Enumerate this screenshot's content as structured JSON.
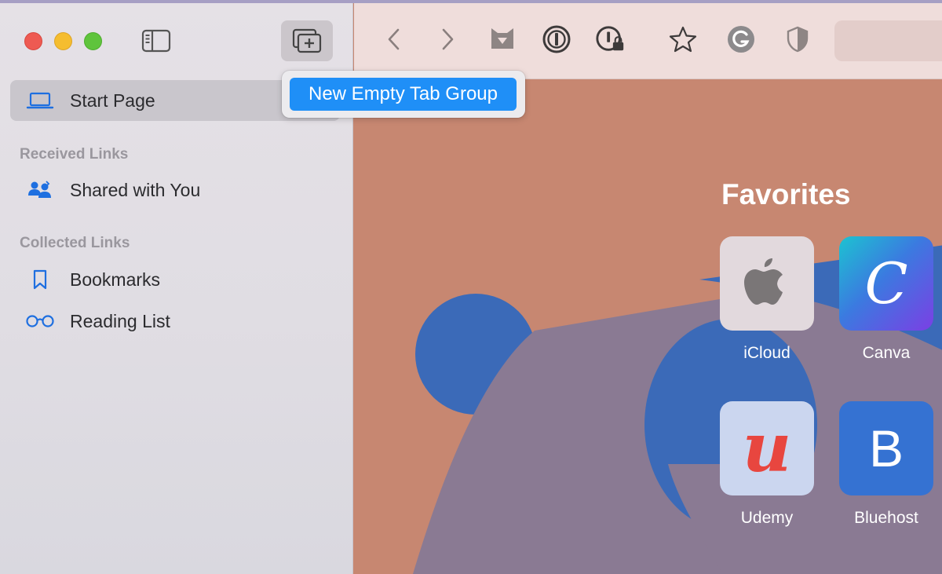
{
  "tooltip": {
    "new_empty_tab_group": "New Empty Tab Group"
  },
  "sidebar": {
    "start_page": "Start Page",
    "sections": [
      {
        "header": "Received Links",
        "items": [
          {
            "label": "Shared with You",
            "icon": "shared-with-you-icon"
          }
        ]
      },
      {
        "header": "Collected Links",
        "items": [
          {
            "label": "Bookmarks",
            "icon": "bookmark-icon"
          },
          {
            "label": "Reading List",
            "icon": "reading-glasses-icon"
          }
        ]
      }
    ]
  },
  "toolbar": {
    "icons": [
      "sidebar-toggle-icon",
      "new-tab-group-icon",
      "back-icon",
      "forward-icon",
      "fox-extension-icon",
      "password-manager-icon",
      "password-lock-icon",
      "star-icon",
      "grammarly-icon",
      "shield-icon"
    ]
  },
  "favorites": {
    "title": "Favorites",
    "items": [
      {
        "label": "iCloud",
        "icon": "apple-logo-icon"
      },
      {
        "label": "Canva",
        "icon": "canva-logo-icon",
        "glyph": "C"
      },
      {
        "label": "Udemy",
        "icon": "udemy-logo-icon",
        "glyph": "u"
      },
      {
        "label": "Bluehost",
        "icon": "bluehost-logo-icon",
        "glyph": "B"
      }
    ]
  },
  "colors": {
    "accent": "#1f8ff7",
    "content_bg": "#c78771",
    "shape_blue": "#3b6ab8",
    "shape_purple": "#8a7a93"
  }
}
